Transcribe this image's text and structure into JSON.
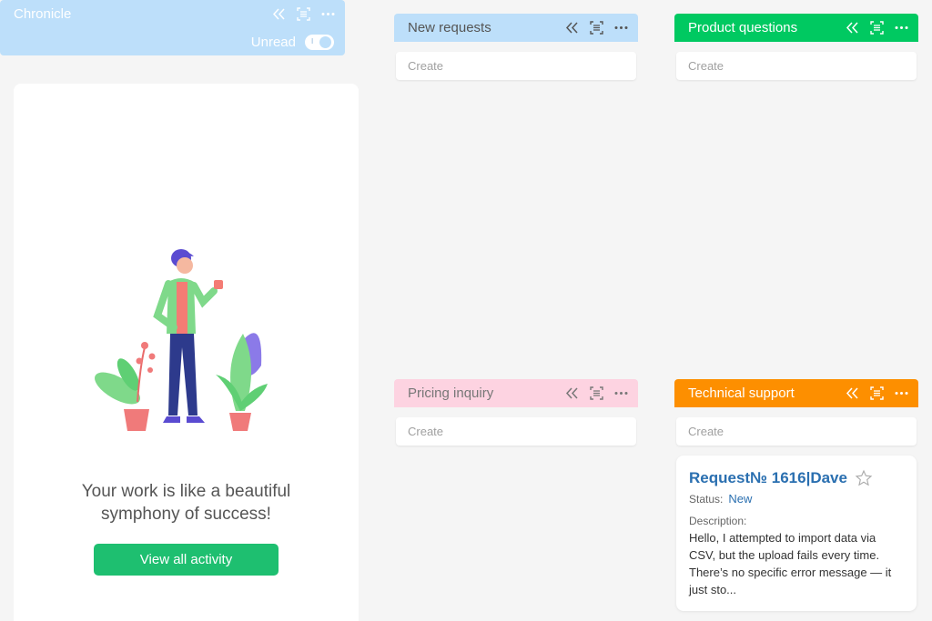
{
  "chronicle": {
    "title": "Chronicle",
    "unread_label": "Unread",
    "message": "Your work is like a beautiful symphony of success!",
    "button_label": "View all activity"
  },
  "columns": [
    {
      "title": "New requests",
      "create_placeholder": "Create",
      "color": "#bddffa",
      "text_color": "#555555"
    },
    {
      "title": "Product questions",
      "create_placeholder": "Create",
      "color": "#00c961",
      "text_color": "#ffffff"
    },
    {
      "title": "Pricing inquiry",
      "create_placeholder": "Create",
      "color": "#fdd3e1",
      "text_color": "#777777"
    },
    {
      "title": "Technical support",
      "create_placeholder": "Create",
      "color": "#fd8f00",
      "text_color": "#ffffff"
    }
  ],
  "card": {
    "title": "Request№ 1616|Dave",
    "status_label": "Status:",
    "status_value": "New",
    "description_label": "Description:",
    "description": "Hello, I attempted to import data via CSV, but the upload fails every time. There’s no specific error message — it just sto..."
  },
  "icons": [
    "collapse-icon",
    "scan-icon",
    "more-icon",
    "star-icon"
  ]
}
